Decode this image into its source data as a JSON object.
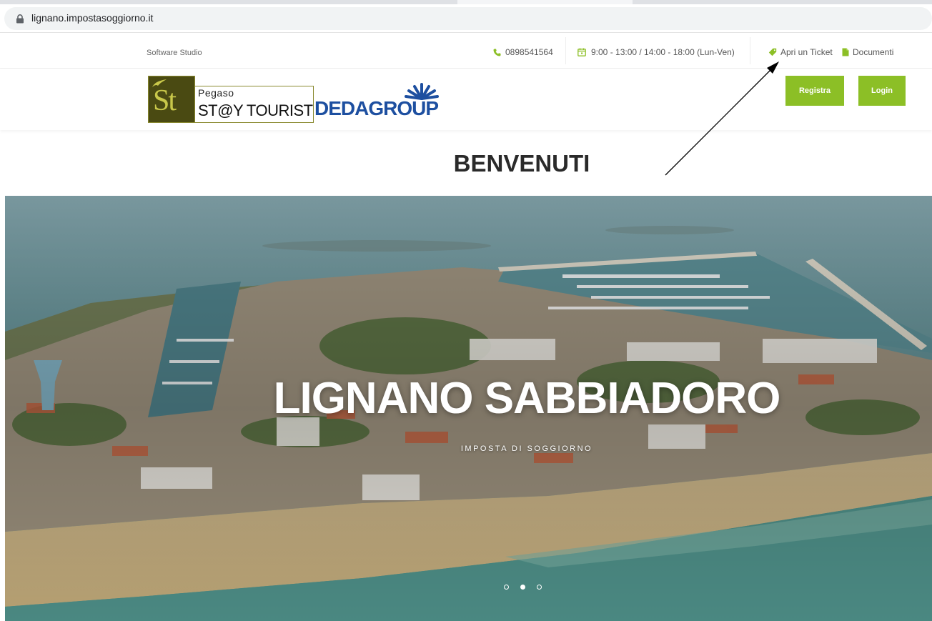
{
  "browser": {
    "url": "lignano.impostasoggiorno.it"
  },
  "topbar": {
    "brand": "Software Studio",
    "phone": "0898541564",
    "hours": "9:00 - 13:00 / 14:00 - 18:00 (Lun-Ven)",
    "ticket_label": "Apri un Ticket",
    "documents_label": "Documenti"
  },
  "header": {
    "logo_pegaso": {
      "monogram": "St",
      "line1": "Pegaso",
      "line2": "ST@Y TOURIST"
    },
    "logo_deda": "DEDAGROUP",
    "register_label": "Registra",
    "login_label": "Login"
  },
  "welcome": "BENVENUTI",
  "hero": {
    "title": "LIGNANO SABBIADORO",
    "subtitle": "IMPOSTA DI SOGGIORNO",
    "slides_total": 3,
    "active_slide": 2
  },
  "colors": {
    "accent": "#8cbf26",
    "deda_blue": "#1d4fa0"
  }
}
